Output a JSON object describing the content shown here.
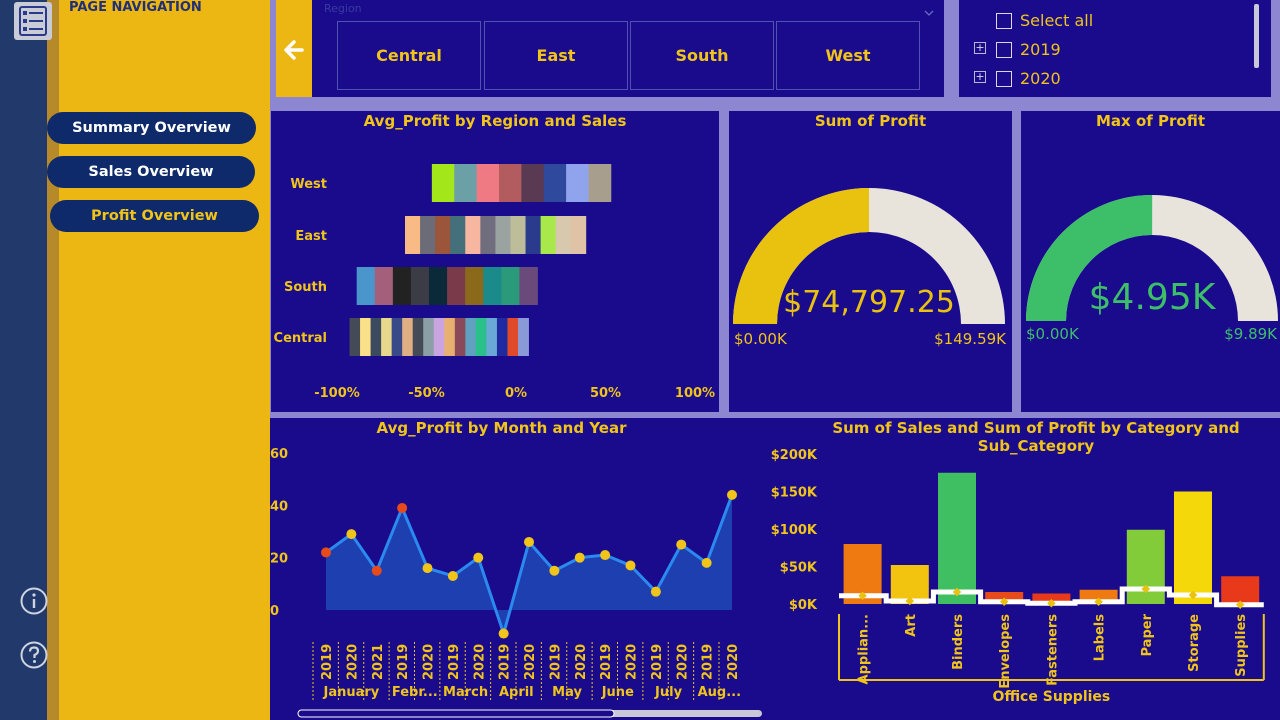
{
  "nav": {
    "title": "PAGE NAVIGATION",
    "items": [
      {
        "label": "Summary Overview"
      },
      {
        "label": "Sales Overview"
      },
      {
        "label": "Profit Overview"
      }
    ]
  },
  "region_slicer": {
    "header": "Region",
    "options": [
      "Central",
      "East",
      "South",
      "West"
    ]
  },
  "year_slicer": {
    "select_all": "Select all",
    "years": [
      "2019",
      "2020"
    ]
  },
  "colors": {
    "background": "#1a0a8c",
    "accent": "#f0c419",
    "nav_bg": "#ecb713",
    "pill": "#0e2a6a",
    "gauge_green": "#3dbf6a",
    "area_fill": "#1d3fb0",
    "line": "#2b8af0"
  },
  "chart_data": [
    {
      "type": "bar",
      "title": "Avg_Profit by Region and Sales",
      "orientation": "horizontal",
      "stacked": true,
      "categories": [
        "West",
        "East",
        "South",
        "Central"
      ],
      "x_ticks": [
        "-100%",
        "-50%",
        "0%",
        "50%",
        "100%"
      ],
      "xlim": [
        -100,
        100
      ],
      "bar_extents": [
        {
          "category": "West",
          "from": -47,
          "to": 53
        },
        {
          "category": "East",
          "from": -62,
          "to": 39
        },
        {
          "category": "South",
          "from": -89,
          "to": 12
        },
        {
          "category": "Central",
          "from": -93,
          "to": 7
        }
      ],
      "segment_colors": {
        "West": [
          "#a3e619",
          "#6aa0a6",
          "#f07a84",
          "#b25c5f",
          "#5a3a52",
          "#2f4a9c",
          "#8fa4ec",
          "#a89e8e"
        ],
        "East": [
          "#f9bb86",
          "#6c6c78",
          "#9a553a",
          "#43707a",
          "#f7b6a0",
          "#6f6d7e",
          "#9aa3a0",
          "#bdbd9a",
          "#2a3a8c",
          "#a8e84a",
          "#d8c8ae",
          "#e0c2a6"
        ],
        "South": [
          "#4a96cc",
          "#a45f7a",
          "#222222",
          "#3c3c46",
          "#0a2a3a",
          "#7a3a4a",
          "#8a6a1a",
          "#1a8a8a",
          "#2a9a7a",
          "#6a4a7a"
        ],
        "Central": [
          "#444a56",
          "#fbe08a",
          "#3c4a60",
          "#e8d88c",
          "#3a4a88",
          "#e0b084",
          "#444a56",
          "#8aa0a6",
          "#caa4e0",
          "#e8b070",
          "#8a4a5a",
          "#60a0c0",
          "#2ac08a",
          "#6aa8d8",
          "#202aa0",
          "#e04a2a",
          "#8a9ad8"
        ]
      }
    },
    {
      "type": "gauge",
      "title": "Sum of Profit",
      "value": 74797.25,
      "value_label": "$74,797.25",
      "min_label": "$0.00K",
      "max_label": "$149.59K",
      "min": 0,
      "max": 149594.5,
      "fill_color": "#e8c20e"
    },
    {
      "type": "gauge",
      "title": "Max of Profit",
      "value": 4950,
      "value_label": "$4.95K",
      "min_label": "$0.00K",
      "max_label": "$9.89K",
      "min": 0,
      "max": 9890,
      "fill_color": "#3dbf6a"
    },
    {
      "type": "area",
      "title": "Avg_Profit by Month and Year",
      "ylim": [
        -10,
        60
      ],
      "y_ticks": [
        "60",
        "40",
        "20",
        "0"
      ],
      "x": [
        {
          "year": "2019",
          "month": "January"
        },
        {
          "year": "2020",
          "month": "January"
        },
        {
          "year": "2021",
          "month": "January"
        },
        {
          "year": "2019",
          "month": "Febr..."
        },
        {
          "year": "2020",
          "month": "Febr..."
        },
        {
          "year": "2019",
          "month": "March"
        },
        {
          "year": "2020",
          "month": "March"
        },
        {
          "year": "2019",
          "month": "April"
        },
        {
          "year": "2020",
          "month": "April"
        },
        {
          "year": "2019",
          "month": "May"
        },
        {
          "year": "2020",
          "month": "May"
        },
        {
          "year": "2019",
          "month": "June"
        },
        {
          "year": "2020",
          "month": "June"
        },
        {
          "year": "2019",
          "month": "July"
        },
        {
          "year": "2020",
          "month": "July"
        },
        {
          "year": "2019",
          "month": "Aug..."
        },
        {
          "year": "2020",
          "month": "Aug..."
        }
      ],
      "month_groups": [
        "January",
        "Febr...",
        "March",
        "April",
        "May",
        "June",
        "July",
        "Aug..."
      ],
      "values": [
        22,
        29,
        15,
        39,
        16,
        13,
        20,
        -9,
        26,
        15,
        20,
        21,
        17,
        7,
        25,
        18,
        44
      ],
      "marker_colors": [
        "#e84a1a",
        "#f0c419",
        "#e84a1a",
        "#e84a1a",
        "#f0c419",
        "#f0c419",
        "#f0c419",
        "#f0c419",
        "#f0c419",
        "#f0c419",
        "#f0c419",
        "#f0c419",
        "#f0c419",
        "#f0c419",
        "#f0c419",
        "#f0c419",
        "#f0c419"
      ]
    },
    {
      "type": "bar",
      "title": "Sum of Sales and Sum of Profit by Category and Sub_Category",
      "category_group": "Office Supplies",
      "categories": [
        "Applian...",
        "Art",
        "Binders",
        "Envelopes",
        "Fasteners",
        "Labels",
        "Paper",
        "Storage",
        "Supplies"
      ],
      "y_ticks": [
        "$200K",
        "$150K",
        "$100K",
        "$50K",
        "$0K"
      ],
      "ylim": [
        0,
        200000
      ],
      "series": [
        {
          "values": [
            80000,
            52000,
            175000,
            16000,
            14000,
            19000,
            99000,
            150000,
            37000
          ],
          "colors": [
            "#f07a12",
            "#f2c410",
            "#3fbf62",
            "#e84a1a",
            "#e8391a",
            "#f07a12",
            "#82cc3a",
            "#f5d80a",
            "#e83a1a"
          ]
        },
        {
          "values": [
            11000,
            4000,
            16000,
            3000,
            1000,
            3000,
            20000,
            12000,
            -1000
          ]
        }
      ]
    }
  ]
}
